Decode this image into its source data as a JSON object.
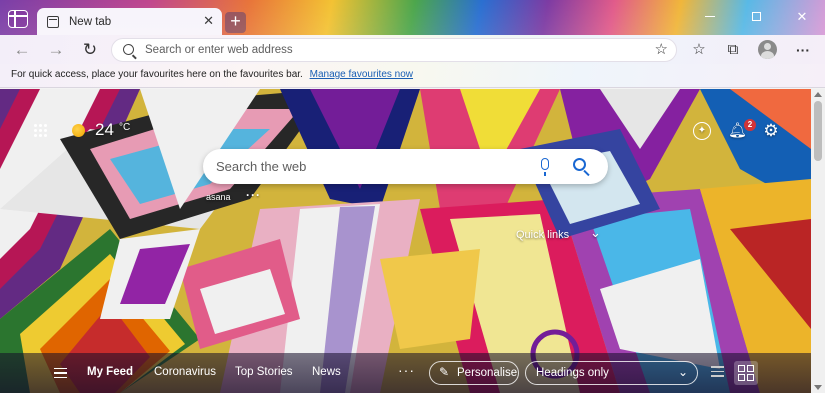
{
  "browser": {
    "tab": {
      "title": "New tab",
      "close": "✕"
    },
    "new_tab": "+",
    "window_controls": {
      "close": "✕"
    },
    "address_bar": {
      "placeholder": "Search or enter web address"
    },
    "favourites_bar": {
      "message": "For quick access, place your favourites here on the favourites bar.",
      "link": "Manage favourites now"
    }
  },
  "newtab": {
    "weather": {
      "temperature": "24",
      "unit": "°C"
    },
    "notifications_count": "2",
    "search": {
      "placeholder": "Search the web"
    },
    "pinned_site": {
      "label": "asana",
      "more": "···"
    },
    "quick_links_label": "Quick links"
  },
  "feed": {
    "items": [
      "My Feed",
      "Coronavirus",
      "Top Stories",
      "News"
    ],
    "more": "···",
    "personalise_label": "Personalise",
    "headings_value": "Headings only"
  },
  "icons": {
    "tab_actions": "tab-actions-icon",
    "favicon": "new-tab-favicon-icon",
    "back": "back-arrow-icon",
    "forward": "forward-arrow-icon",
    "refresh": "refresh-icon",
    "search": "search-icon",
    "add_favourite": "star-plus-icon",
    "favourites": "favourites-icon",
    "collections": "collections-icon",
    "profile": "profile-avatar-icon",
    "more": "more-icon",
    "apps": "apps-grid-icon",
    "weather": "sun-icon",
    "rewards": "rewards-icon",
    "notifications": "bell-icon",
    "settings": "gear-icon",
    "mic": "microphone-icon"
  },
  "colors": {
    "link": "#1a5fb4",
    "search_accent": "#1967d2",
    "badge": "#d13438"
  }
}
